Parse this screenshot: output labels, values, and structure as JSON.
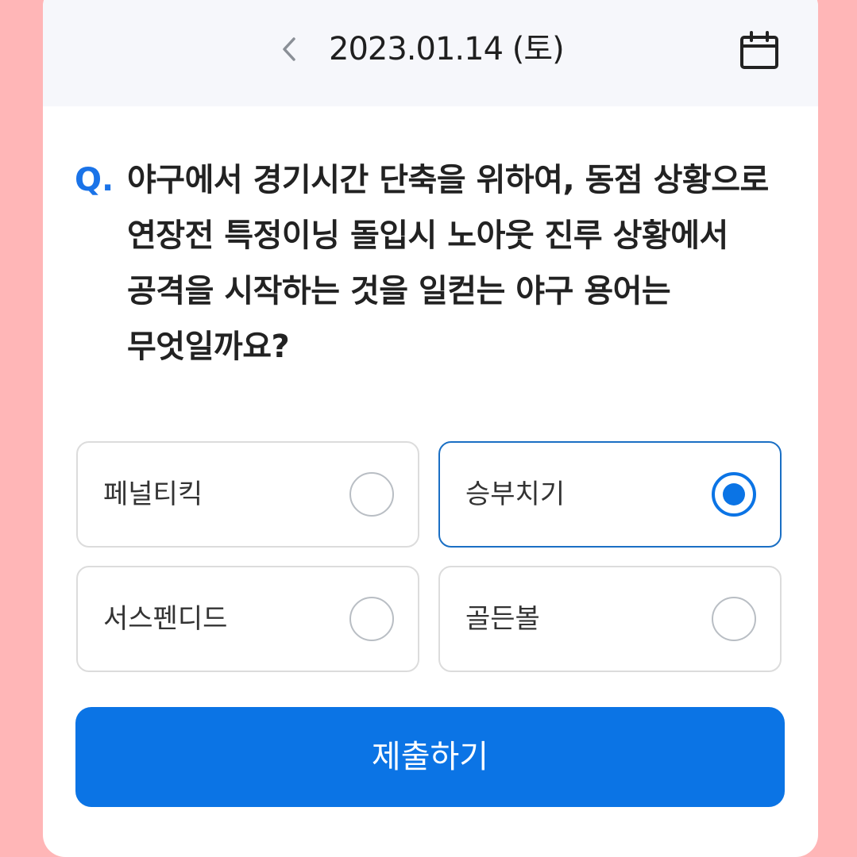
{
  "header": {
    "date": "2023.01.14 (토)",
    "back_icon": "chevron-left-icon",
    "calendar_icon": "calendar-icon"
  },
  "question": {
    "prefix": "Q.",
    "text": "야구에서 경기시간 단축을 위하여, 동점 상황으로 연장전 특정이닝 돌입시 노아웃 진루 상황에서 공격을 시작하는 것을 일컫는 야구 용어는 무엇일까요?"
  },
  "options": [
    {
      "label": "페널티킥",
      "selected": false
    },
    {
      "label": "승부치기",
      "selected": true
    },
    {
      "label": "서스펜디드",
      "selected": false
    },
    {
      "label": "골든볼",
      "selected": false
    }
  ],
  "submit_label": "제출하기",
  "colors": {
    "accent": "#0b74e5",
    "background": "#ffb6b7",
    "header_bg": "#f6f7fb",
    "selected_border": "#1a6fc4"
  }
}
